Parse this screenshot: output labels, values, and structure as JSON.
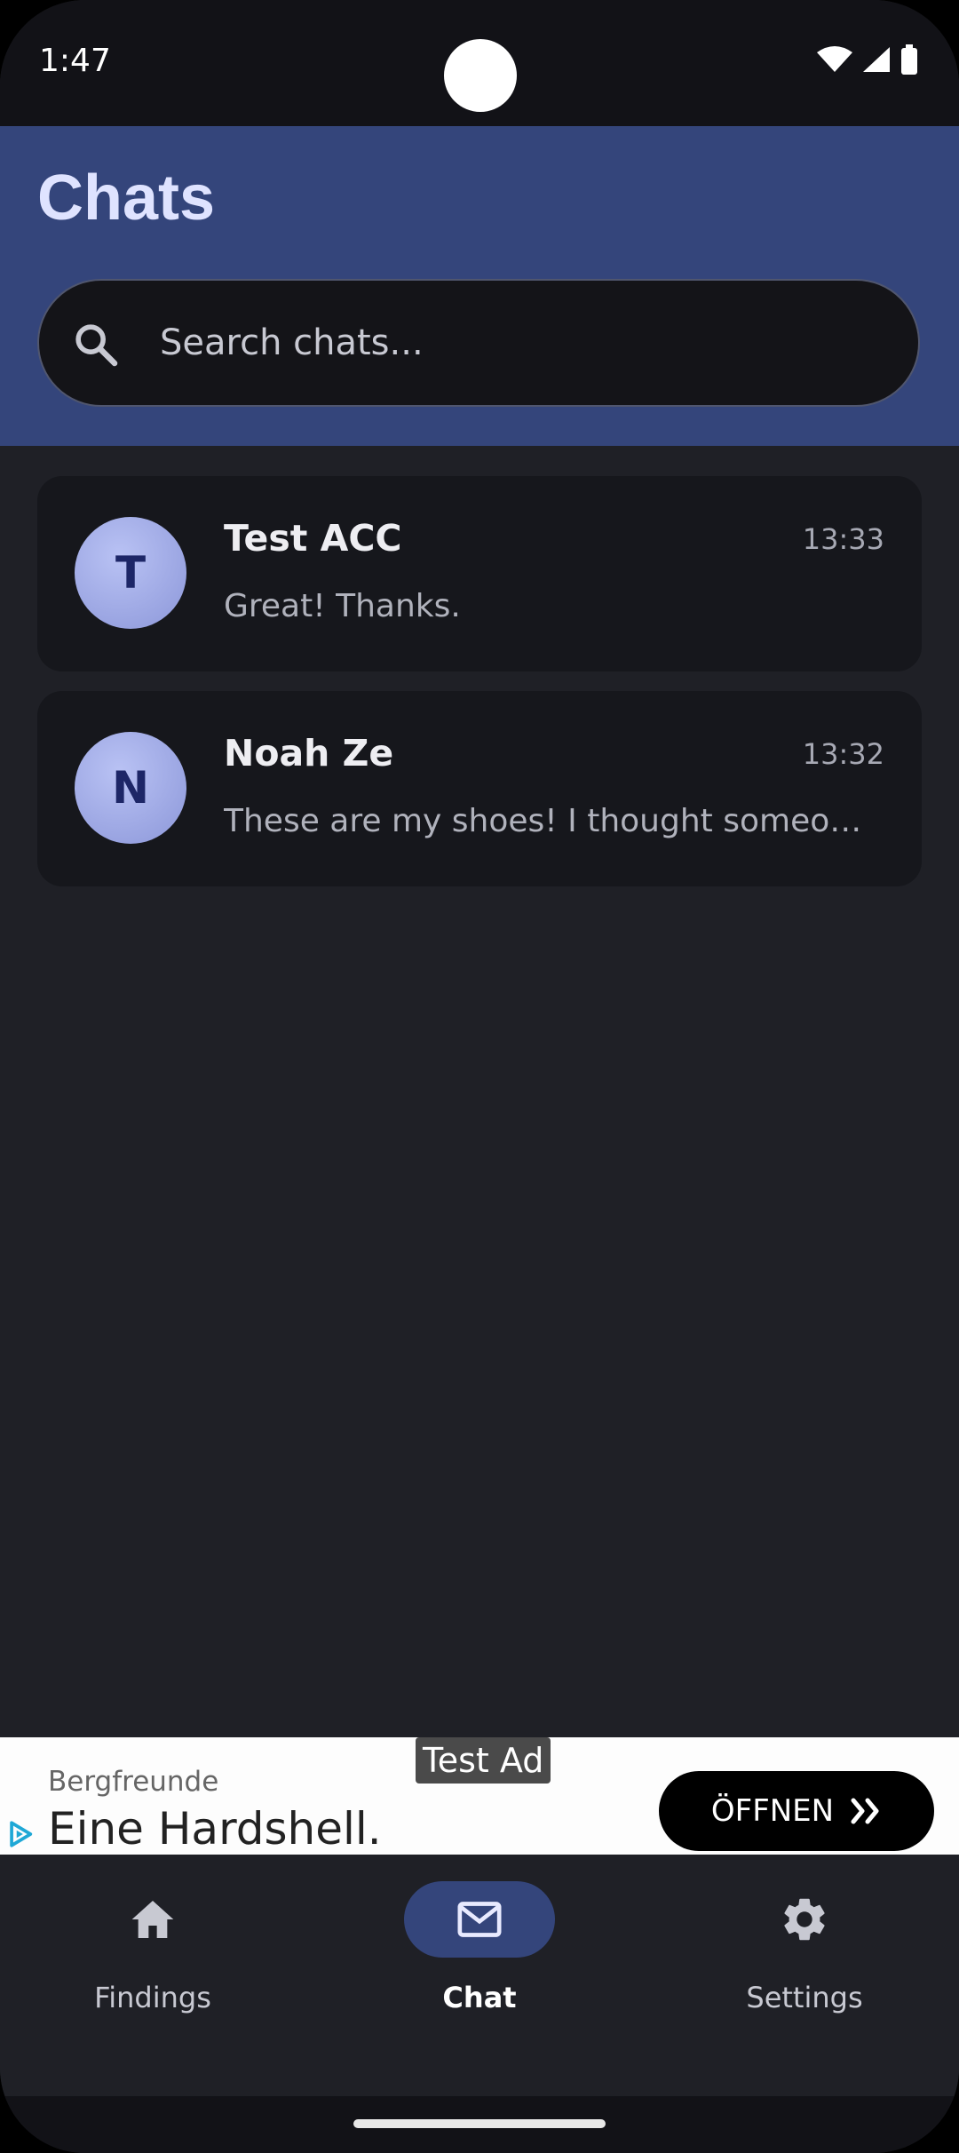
{
  "status_bar": {
    "time": "1:47"
  },
  "header": {
    "title": "Chats"
  },
  "search": {
    "placeholder": "Search chats..."
  },
  "chats": [
    {
      "initial": "T",
      "name": "Test ACC",
      "time": "13:33",
      "preview": "Great! Thanks."
    },
    {
      "initial": "N",
      "name": "Noah Ze",
      "time": "13:32",
      "preview": "These are my shoes! I thought someone …"
    }
  ],
  "ad": {
    "label": "Test Ad",
    "brand": "Bergfreunde",
    "headline": "Eine Hardshell.",
    "cta": "ÖFFNEN"
  },
  "nav": {
    "items": [
      {
        "label": "Findings",
        "icon": "home-icon"
      },
      {
        "label": "Chat",
        "icon": "mail-icon"
      },
      {
        "label": "Settings",
        "icon": "gear-icon"
      }
    ],
    "active": "Chat"
  },
  "colors": {
    "header_bg": "#34457b",
    "accent": "#dfe3ff",
    "background": "#1f2026",
    "avatar": "#9fa9e6"
  }
}
